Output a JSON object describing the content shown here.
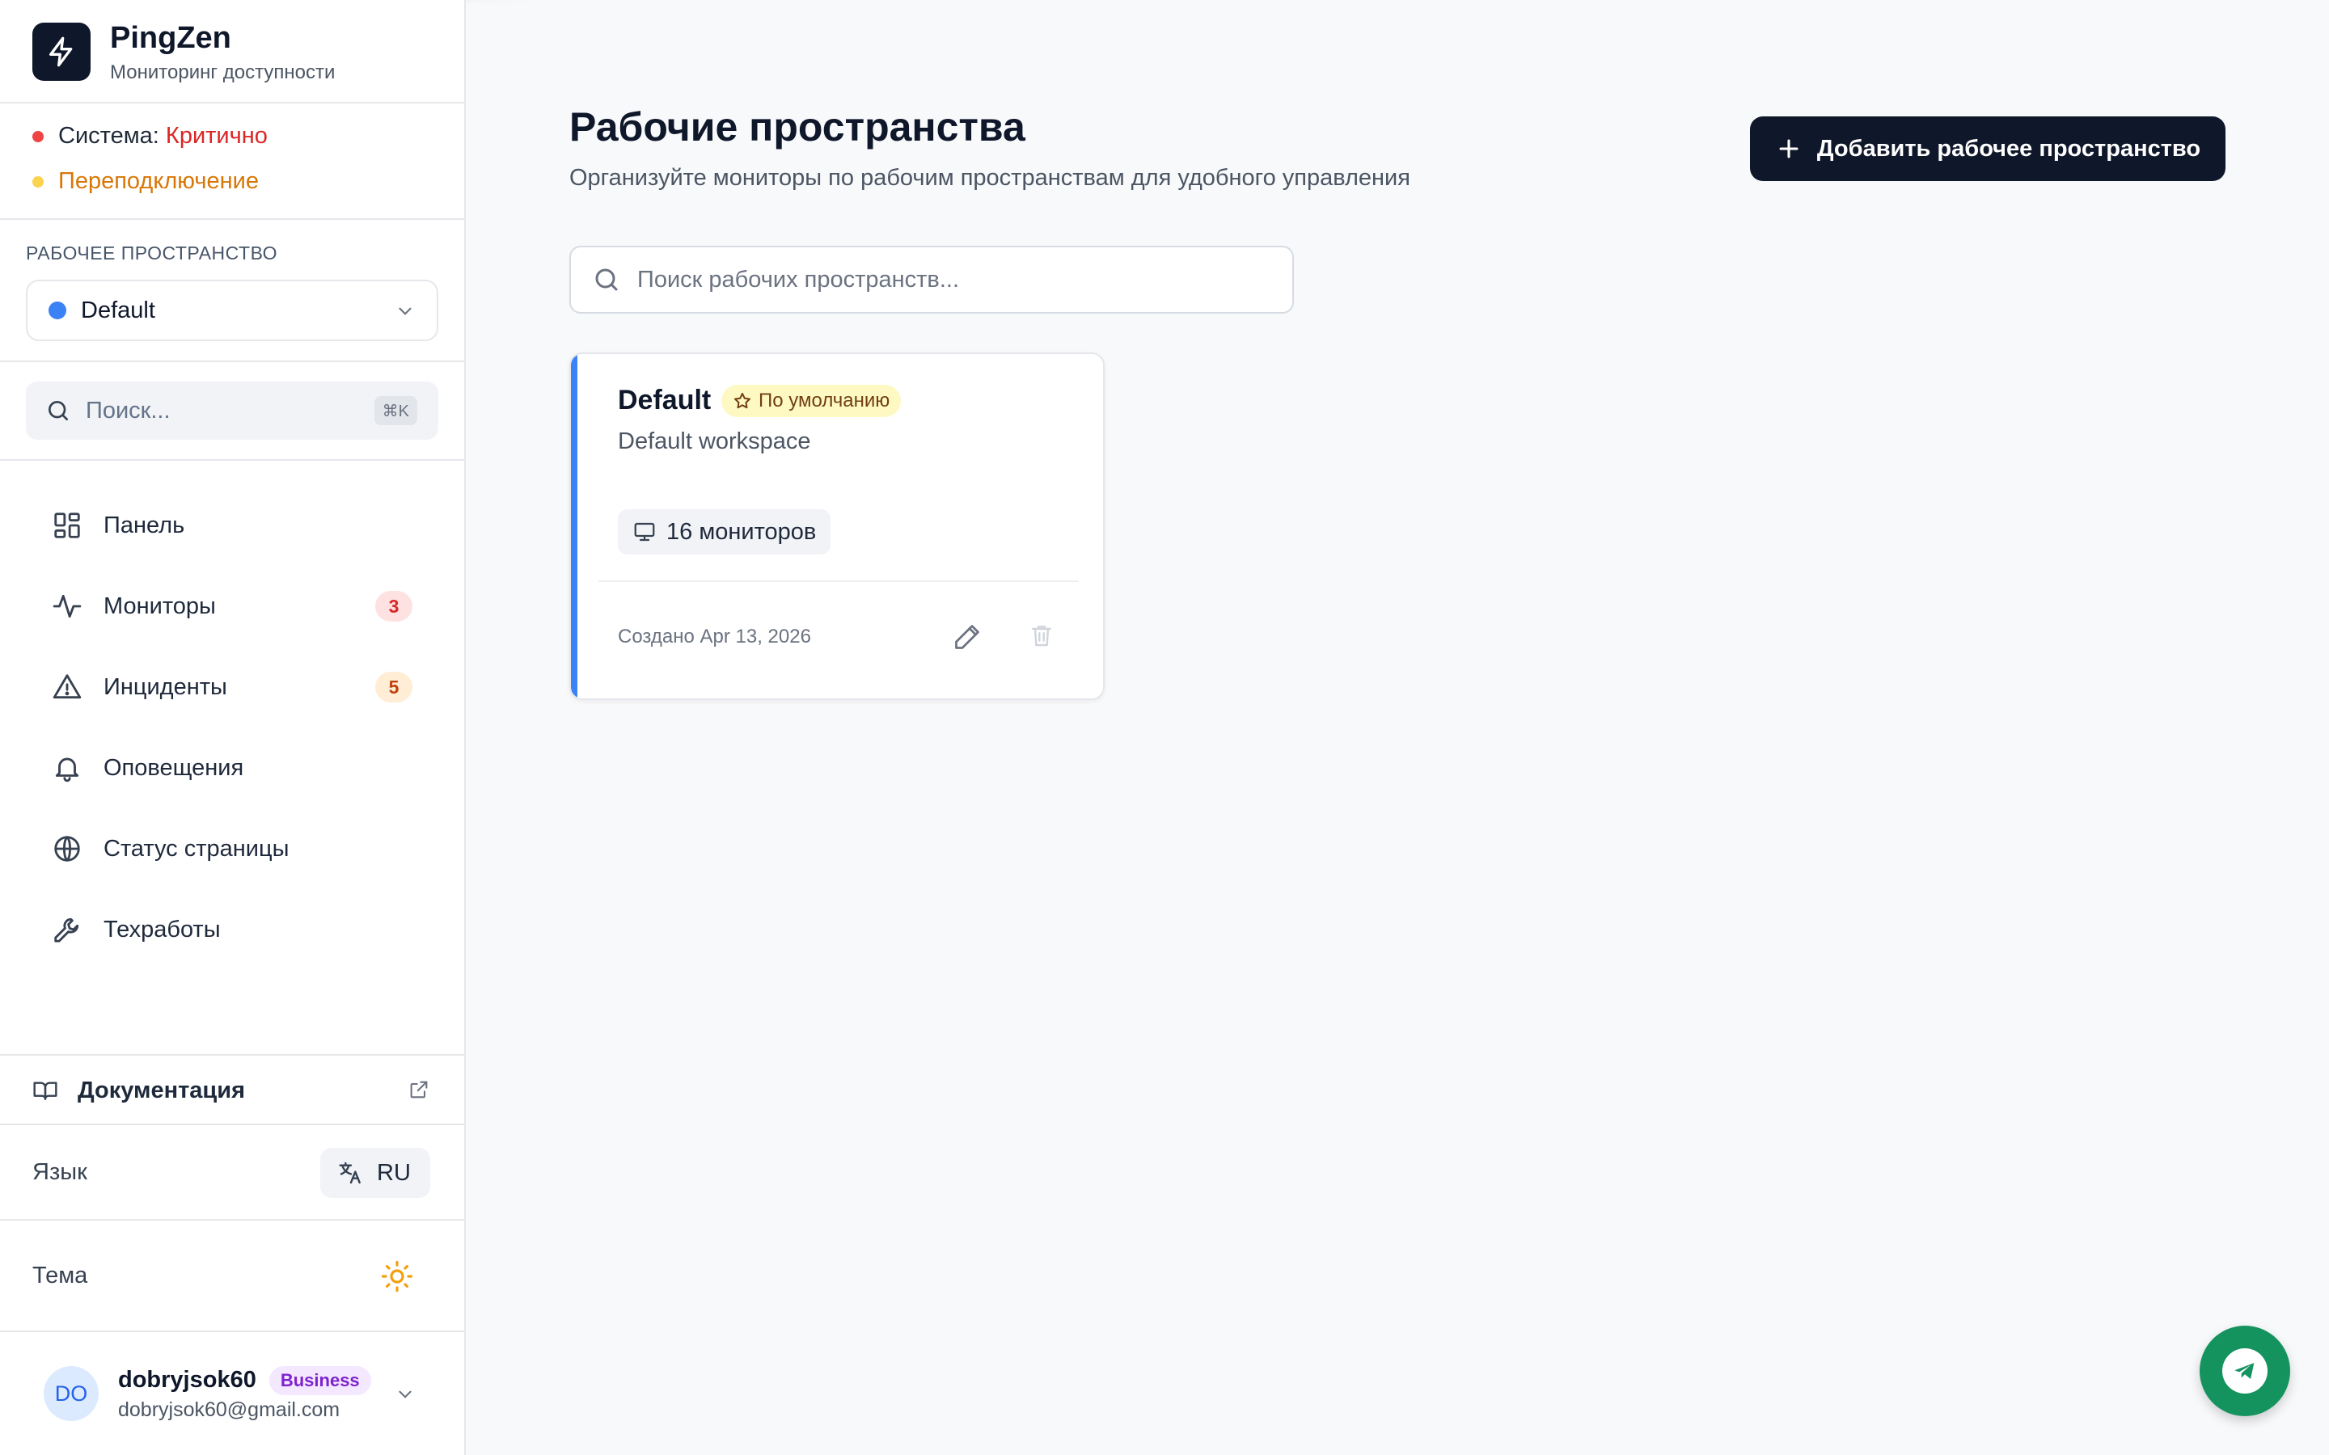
{
  "brand": {
    "name": "PingZen",
    "subtitle": "Мониторинг доступности"
  },
  "status": {
    "system_label": "Система: ",
    "system_value": "Критично",
    "system_color": "#dc2626",
    "connection": "Переподключение",
    "connection_color": "#d97706"
  },
  "workspace_selector": {
    "label": "РАБОЧЕЕ ПРОСТРАНСТВО",
    "selected": "Default",
    "dot_color": "#3b82f6"
  },
  "sidebar_search": {
    "placeholder": "Поиск...",
    "shortcut": "⌘K"
  },
  "nav": [
    {
      "label": "Панель",
      "icon": "dashboard-icon",
      "badge": null
    },
    {
      "label": "Мониторы",
      "icon": "activity-icon",
      "badge": "3"
    },
    {
      "label": "Инциденты",
      "icon": "alert-triangle-icon",
      "badge": "5"
    },
    {
      "label": "Оповещения",
      "icon": "bell-icon",
      "badge": null
    },
    {
      "label": "Статус страницы",
      "icon": "globe-icon",
      "badge": null
    },
    {
      "label": "Техработы",
      "icon": "wrench-icon",
      "badge": null
    }
  ],
  "bottom": {
    "docs": "Документация",
    "language_label": "Язык",
    "language_value": "RU",
    "theme_label": "Тема"
  },
  "user": {
    "initials": "DO",
    "name": "dobryjsok60",
    "plan": "Business",
    "email": "dobryjsok60@gmail.com"
  },
  "main": {
    "title": "Рабочие пространства",
    "subtitle": "Организуйте мониторы по рабочим пространствам для удобного управления",
    "add_button": "Добавить рабочее пространство",
    "search_placeholder": "Поиск рабочих пространств..."
  },
  "workspaces": [
    {
      "name": "Default",
      "badge": "По умолчанию",
      "description": "Default workspace",
      "monitors": "16 мониторов",
      "created": "Создано Apr 13, 2026",
      "accent_color": "#3b82f6"
    }
  ],
  "colors": {
    "accent": "#3b82f6",
    "primary_button": "#0f172a",
    "fab": "#15935f"
  }
}
